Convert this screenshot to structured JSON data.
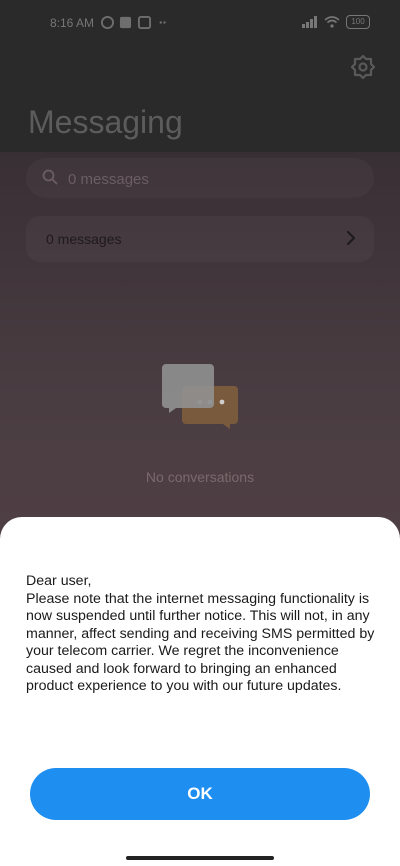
{
  "status_bar": {
    "time": "8:16 AM",
    "battery": "100"
  },
  "header": {
    "title": "Messaging",
    "settings_icon": "gear-icon"
  },
  "search": {
    "placeholder": "0 messages",
    "icon": "search-icon"
  },
  "message_row": {
    "label": "0 messages",
    "icon": "chevron-right-icon"
  },
  "empty_state": {
    "icon": "chat-bubbles-icon",
    "text": "No conversations"
  },
  "dialog": {
    "message": "Dear user,\nPlease note that the internet messaging functionality is now suspended until further notice. This will not, in any manner, affect sending and receiving SMS permitted by your telecom carrier. We regret the inconvenience caused and look forward to bringing an enhanced product experience to you with our future updates.",
    "ok_label": "OK"
  },
  "colors": {
    "accent": "#1f8ef1",
    "dialog_bg": "#ffffff",
    "header_bg": "#2a2a2a",
    "overlay_bottom": "#5a4448"
  }
}
